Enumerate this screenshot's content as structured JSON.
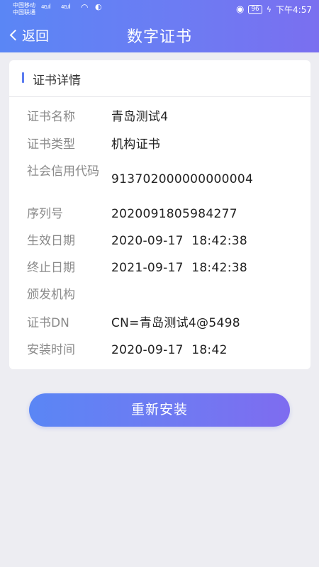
{
  "status_bar": {
    "carrier_1": "中国移动",
    "carrier_2": "中国联通",
    "net_1": "4G",
    "net_2": "4G",
    "battery": "96",
    "time": "下午4:57"
  },
  "nav": {
    "back_label": "返回",
    "title": "数字证书"
  },
  "card": {
    "title": "证书详情",
    "rows": [
      {
        "label": "证书名称",
        "value": "青岛测试4"
      },
      {
        "label": "证书类型",
        "value": "机构证书"
      },
      {
        "label": "社会信用代码",
        "value": "913702000000000004"
      },
      {
        "label": "序列号",
        "value": "2020091805984277"
      },
      {
        "label": "生效日期",
        "value": "2020-09-17  18:42:38"
      },
      {
        "label": "终止日期",
        "value": "2021-09-17  18:42:38"
      },
      {
        "label": "颁发机构",
        "value": ""
      },
      {
        "label": "证书DN",
        "value": "CN=青岛测试4@5498"
      },
      {
        "label": "安装时间",
        "value": "2020-09-17  18:42"
      }
    ]
  },
  "actions": {
    "reinstall_label": "重新安装"
  },
  "colors": {
    "accent": "#5b7cf0",
    "header_gradient_start": "#5a86f5",
    "header_gradient_end": "#7a6ff0",
    "background": "#ededf2"
  }
}
